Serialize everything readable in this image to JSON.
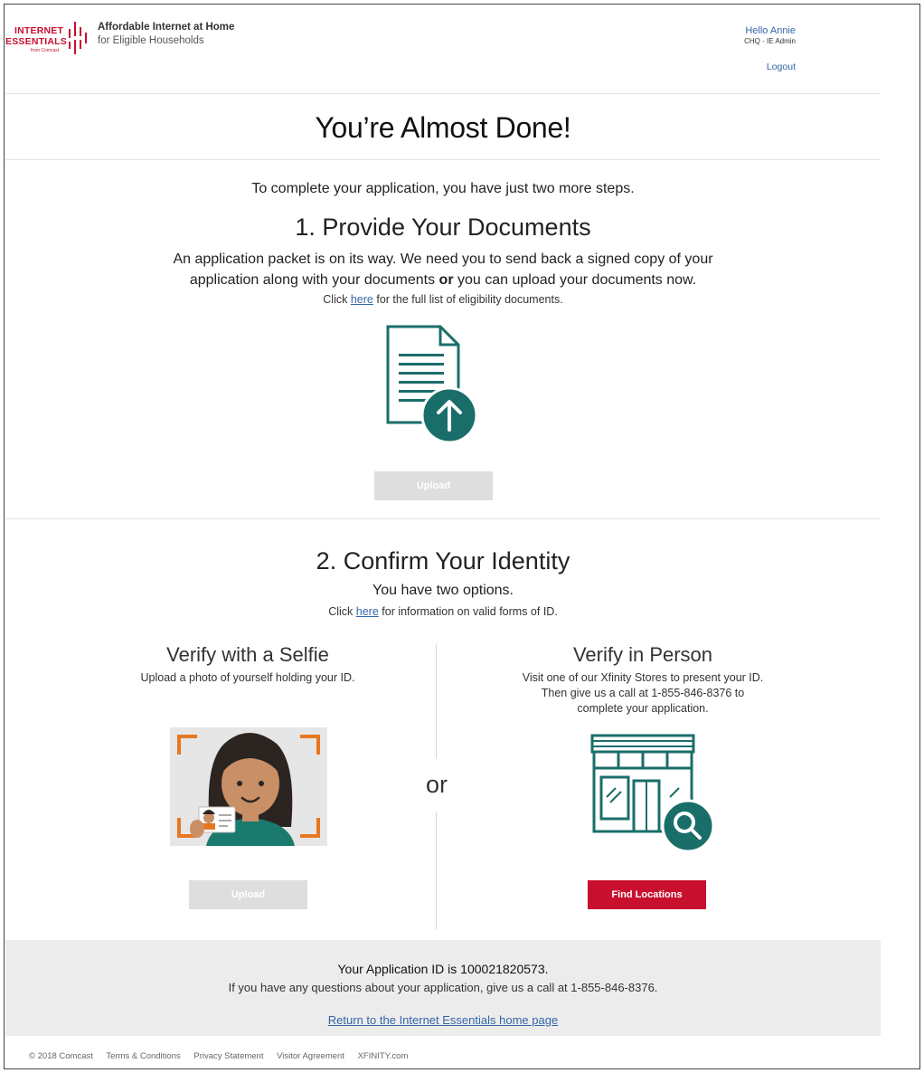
{
  "header": {
    "logo_line1": "INTERNET",
    "logo_line2": "ESSENTIALS",
    "logo_line3": "from Comcast",
    "tagline_bold": "Affordable Internet at Home",
    "tagline": "for Eligible Households",
    "greeting": "Hello Annie",
    "role": "CHQ - IE Admin",
    "logout": "Logout"
  },
  "title": "You’re Almost Done!",
  "intro": "To complete your application, you have just two more steps.",
  "step1": {
    "title": "1. Provide Your Documents",
    "desc_line1": "An application packet is on its way. We need you to send back a signed copy of your",
    "desc_line2_a": "application along with your documents ",
    "desc_line2_or": "or",
    "desc_line2_b": " you can upload your documents now.",
    "note_pre": "Click ",
    "note_link": "here",
    "note_post": " for the full list of eligibility documents.",
    "upload_label": "Upload"
  },
  "step2": {
    "title": "2. Confirm Your Identity",
    "subtitle": "You have two options.",
    "note_pre": "Click ",
    "note_link": "here",
    "note_post": " for information on valid forms of ID.",
    "or_label": "or",
    "selfie": {
      "title": "Verify with a Selfie",
      "desc": "Upload a photo of yourself holding your ID.",
      "button": "Upload"
    },
    "person": {
      "title": "Verify in Person",
      "desc_line1": "Visit one of our Xfinity Stores to present your ID.",
      "desc_line2": "Then give us a call at 1-855-846-8376 to",
      "desc_line3": "complete your application.",
      "button": "Find Locations"
    }
  },
  "app_band": {
    "app_id": "Your Application ID is 100021820573.",
    "question": "If you have any questions about your application, give us a call at 1-855-846-8376.",
    "return_link": "Return to the Internet Essentials home page"
  },
  "footer": {
    "copyright": "© 2018 Comcast",
    "links": [
      "Terms & Conditions",
      "Privacy Statement",
      "Visitor Agreement",
      "XFINITY.com"
    ]
  },
  "colors": {
    "brand_red": "#c8102e",
    "teal": "#1a6e6a",
    "link_blue": "#3566a8",
    "accent_orange": "#e87722"
  }
}
